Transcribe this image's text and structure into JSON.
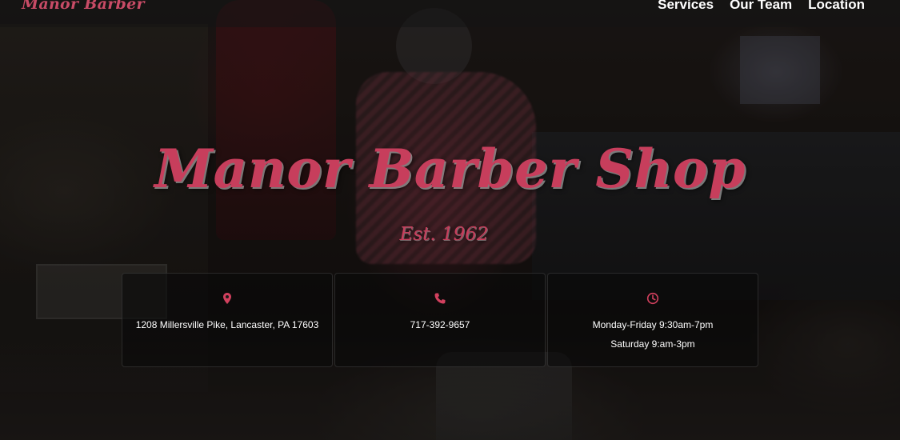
{
  "brand": {
    "logo_text": "Manor Barber",
    "accent_color": "#c73e5c"
  },
  "nav": {
    "items": [
      {
        "label": "Services"
      },
      {
        "label": "Our Team"
      },
      {
        "label": "Location"
      }
    ]
  },
  "hero": {
    "title": "Manor Barber Shop",
    "subtitle": "Est. 1962"
  },
  "info_cards": [
    {
      "icon": "map-pin-icon",
      "lines": [
        "1208 Millersville Pike, Lancaster, PA 17603"
      ]
    },
    {
      "icon": "phone-icon",
      "lines": [
        "717-392-9657"
      ]
    },
    {
      "icon": "clock-icon",
      "lines": [
        "Monday-Friday 9:30am-7pm",
        "Saturday 9:am-3pm"
      ]
    }
  ]
}
